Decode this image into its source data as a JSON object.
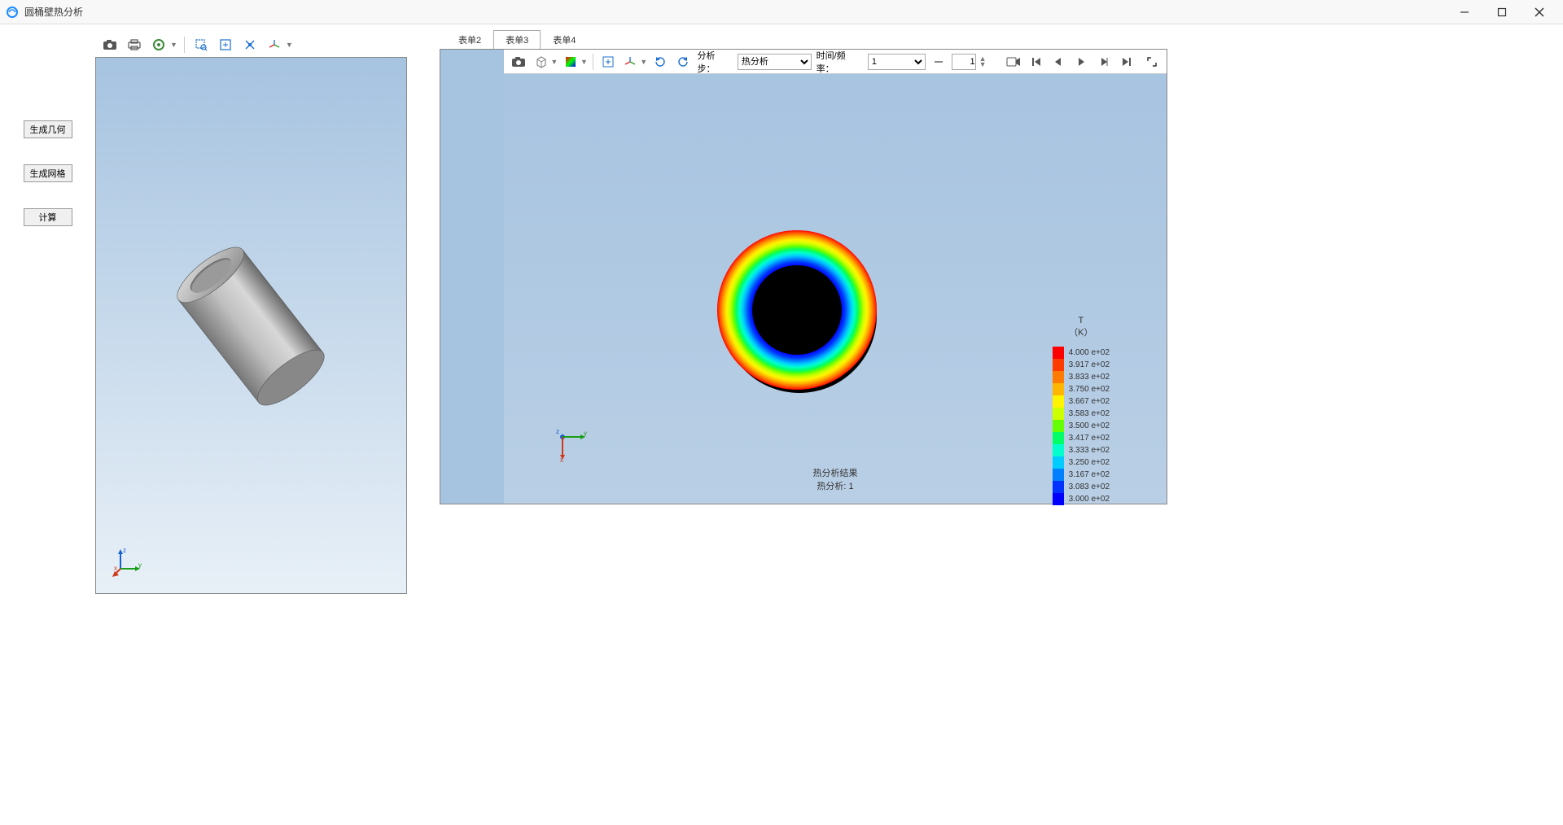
{
  "window": {
    "title": "圆桶壁热分析"
  },
  "left_buttons": {
    "gen_geom": "生成几何",
    "gen_mesh": "生成网格",
    "compute": "计算"
  },
  "tabs": [
    {
      "id": "t2",
      "label": "表单2",
      "active": false
    },
    {
      "id": "t3",
      "label": "表单3",
      "active": true
    },
    {
      "id": "t4",
      "label": "表单4",
      "active": false
    }
  ],
  "result_toolbar": {
    "step_label": "分析步：",
    "step_select": "热分析",
    "time_label": "时间/频率：",
    "time_select": "1",
    "frame_input": "1"
  },
  "result_caption": {
    "line1": "热分析结果",
    "line2": "热分析: 1"
  },
  "legend": {
    "title_var": "T",
    "title_unit": "（K）",
    "items": [
      {
        "color": "#ff0000",
        "label": "4.000 e+02"
      },
      {
        "color": "#ff3b00",
        "label": "3.917 e+02"
      },
      {
        "color": "#ff7a00",
        "label": "3.833 e+02"
      },
      {
        "color": "#ffb600",
        "label": "3.750 e+02"
      },
      {
        "color": "#fff400",
        "label": "3.667 e+02"
      },
      {
        "color": "#ccff00",
        "label": "3.583 e+02"
      },
      {
        "color": "#66ff00",
        "label": "3.500 e+02"
      },
      {
        "color": "#00ff66",
        "label": "3.417 e+02"
      },
      {
        "color": "#00ffcc",
        "label": "3.333 e+02"
      },
      {
        "color": "#00ccff",
        "label": "3.250 e+02"
      },
      {
        "color": "#0080ff",
        "label": "3.167 e+02"
      },
      {
        "color": "#0033ff",
        "label": "3.083 e+02"
      },
      {
        "color": "#0000ff",
        "label": "3.000 e+02"
      }
    ]
  },
  "triad_labels": {
    "x": "x",
    "y": "y",
    "z": "z"
  },
  "chart_data": {
    "type": "heatmap",
    "title": "热分析结果",
    "variable": "T",
    "unit": "K",
    "range": [
      300,
      400
    ],
    "description": "Radial temperature distribution on annular cross-section of cylinder wall; outer radius ≈ 400 K, inner radius ≈ 300 K",
    "colorscale_stops": [
      {
        "value": 400.0,
        "color": "#ff0000"
      },
      {
        "value": 391.7,
        "color": "#ff3b00"
      },
      {
        "value": 383.3,
        "color": "#ff7a00"
      },
      {
        "value": 375.0,
        "color": "#ffb600"
      },
      {
        "value": 366.7,
        "color": "#fff400"
      },
      {
        "value": 358.3,
        "color": "#ccff00"
      },
      {
        "value": 350.0,
        "color": "#66ff00"
      },
      {
        "value": 341.7,
        "color": "#00ff66"
      },
      {
        "value": 333.3,
        "color": "#00ffcc"
      },
      {
        "value": 325.0,
        "color": "#00ccff"
      },
      {
        "value": 316.7,
        "color": "#0080ff"
      },
      {
        "value": 308.3,
        "color": "#0033ff"
      },
      {
        "value": 300.0,
        "color": "#0000ff"
      }
    ]
  }
}
